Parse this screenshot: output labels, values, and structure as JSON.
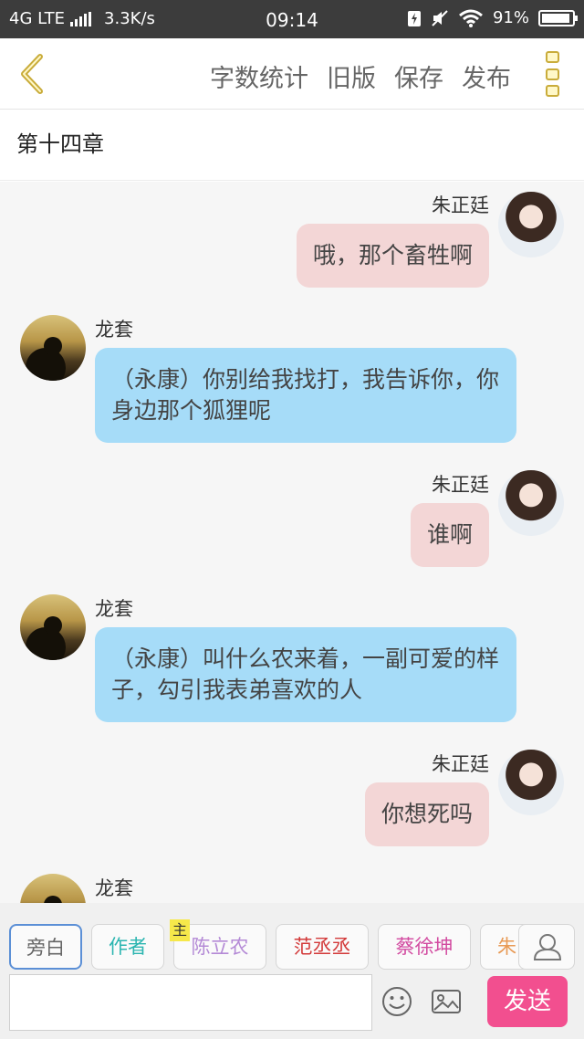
{
  "status_bar": {
    "network": "4G LTE",
    "speed": "3.3K/s",
    "time": "09:14",
    "battery": "91%"
  },
  "header": {
    "actions": [
      "字数统计",
      "旧版",
      "保存",
      "发布"
    ]
  },
  "chapter_title": "第十四章",
  "messages": [
    {
      "speaker": "朱正廷",
      "text": "哦，那个畜牲啊"
    },
    {
      "speaker": "龙套",
      "text": "（永康）你别给我找打，我告诉你，你身边那个狐狸呢"
    },
    {
      "speaker": "朱正廷",
      "text": "谁啊"
    },
    {
      "speaker": "龙套",
      "text": "（永康）叫什么农来着，一副可爱的样子，勾引我表弟喜欢的人"
    },
    {
      "speaker": "朱正廷",
      "text": "你想死吗"
    },
    {
      "speaker": "龙套",
      "text": ""
    }
  ],
  "roles": [
    {
      "label": "旁白",
      "color": "#666666"
    },
    {
      "label": "作者",
      "color": "#2bb5b0"
    },
    {
      "label": "陈立农",
      "color": "#b48ad6"
    },
    {
      "label": "范丞丞",
      "color": "#d33a3a"
    },
    {
      "label": "蔡徐坤",
      "color": "#d24aa0"
    },
    {
      "label": "朱",
      "color": "#e89a55"
    }
  ],
  "main_tag": "主",
  "input": {
    "placeholder": "",
    "value": ""
  },
  "send_label": "发送",
  "colors": {
    "accent": "#f24f8f",
    "bubble_right": "#f3d6d6",
    "bubble_left": "#a6dcf8",
    "back_icon": "#c9ac3a"
  }
}
